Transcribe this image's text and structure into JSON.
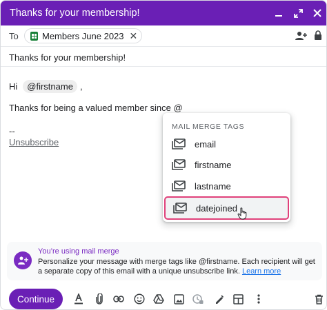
{
  "window": {
    "title": "Thanks for your membership!",
    "controls": [
      "minimize-icon",
      "expand-icon",
      "close-icon"
    ]
  },
  "recipients": {
    "to_label": "To",
    "chip_label": "Members June 2023",
    "chip_icon": "google-sheets-icon"
  },
  "subject": "Thanks for your membership!",
  "body": {
    "greeting_prefix": "Hi",
    "greeting_tag": "@firstname",
    "greeting_suffix": ",",
    "line2": "Thanks for being a valued member since @",
    "signature_dash": "--",
    "unsubscribe": "Unsubscribe"
  },
  "dropdown": {
    "header": "MAIL MERGE TAGS",
    "items": [
      {
        "label": "email"
      },
      {
        "label": "firstname"
      },
      {
        "label": "lastname"
      },
      {
        "label": "datejoined",
        "highlighted": true
      }
    ]
  },
  "banner": {
    "title": "You’re using mail merge",
    "text": "Personalize your message with merge tags like @firstname. Each recipient will get a separate copy of this email with a unique unsubscribe link.",
    "link": "Learn more"
  },
  "toolbar": {
    "continue_label": "Continue",
    "icons": [
      "format-text-icon",
      "attach-icon",
      "link-icon",
      "emoji-icon",
      "drive-icon",
      "photo-icon",
      "confidential-mode-icon",
      "signature-icon",
      "layout-icon",
      "more-options-icon",
      "delete-icon"
    ]
  },
  "colors": {
    "accent": "#6a1fb5",
    "highlight_border": "#e0407a",
    "link": "#1a73e8"
  }
}
